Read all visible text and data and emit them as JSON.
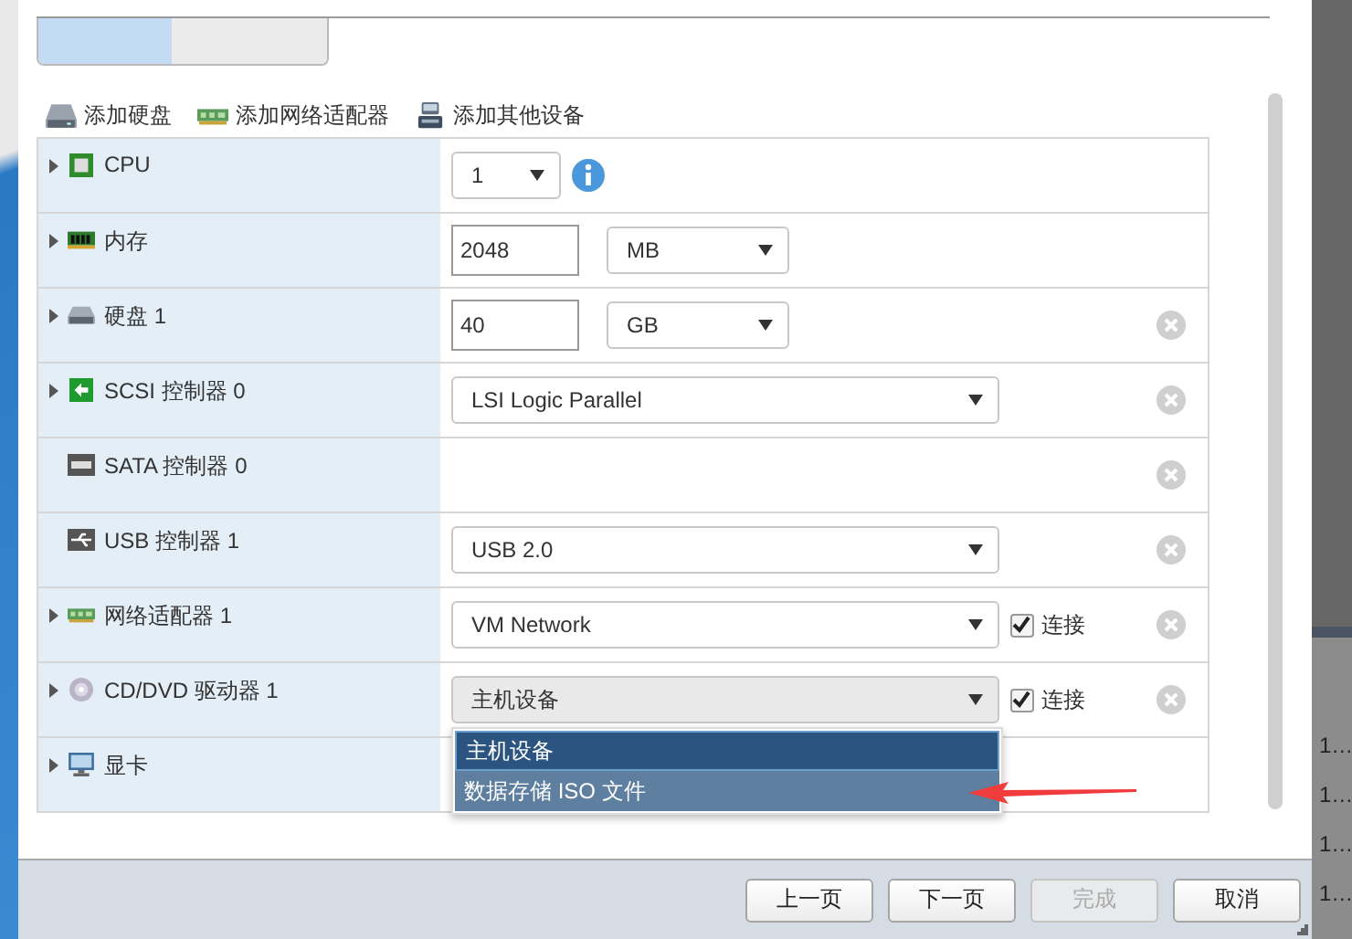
{
  "tabs": [
    {
      "selected": true
    },
    {
      "selected": false
    }
  ],
  "toolbar": [
    {
      "kind": "disk",
      "label": "添加硬盘"
    },
    {
      "kind": "network",
      "label": "添加网络适配器"
    },
    {
      "kind": "device",
      "label": "添加其他设备"
    }
  ],
  "devices": [
    {
      "kind": "cpu",
      "label": "CPU",
      "expandable": true,
      "removable": false,
      "controls": [
        {
          "kind": "count",
          "value": "1",
          "open": false
        },
        {
          "kind": "info"
        }
      ]
    },
    {
      "kind": "memory",
      "label": "内存",
      "expandable": true,
      "removable": false,
      "controls": [
        {
          "kind": "input",
          "value": "2048"
        },
        {
          "kind": "unit",
          "value": "MB",
          "open": false
        }
      ]
    },
    {
      "kind": "disk",
      "label": "硬盘 1",
      "expandable": true,
      "removable": true,
      "controls": [
        {
          "kind": "input",
          "value": "40"
        },
        {
          "kind": "unit",
          "value": "GB",
          "open": false
        }
      ]
    },
    {
      "kind": "scsi",
      "label": "SCSI 控制器 0",
      "expandable": true,
      "removable": true,
      "controls": [
        {
          "kind": "select",
          "value": "LSI Logic Parallel",
          "open": false
        }
      ]
    },
    {
      "kind": "sata",
      "label": "SATA 控制器 0",
      "expandable": false,
      "removable": true
    },
    {
      "kind": "usb",
      "label": "USB 控制器 1",
      "expandable": false,
      "removable": true,
      "controls": [
        {
          "kind": "select",
          "value": "USB 2.0",
          "open": false
        }
      ]
    },
    {
      "kind": "network",
      "label": "网络适配器 1",
      "expandable": true,
      "removable": true,
      "controls": [
        {
          "kind": "select",
          "value": "VM Network",
          "open": false
        },
        {
          "kind": "checkbox",
          "label": "连接",
          "checked": true
        }
      ]
    },
    {
      "kind": "cdrom",
      "label": "CD/DVD 驱动器 1",
      "expandable": true,
      "removable": true,
      "controls": [
        {
          "kind": "select",
          "value": "主机设备",
          "open": true,
          "options": [
            {
              "label": "主机设备",
              "selected": true
            },
            {
              "label": "数据存储 ISO 文件",
              "selected": false
            }
          ]
        },
        {
          "kind": "checkbox",
          "label": "连接",
          "checked": true
        }
      ]
    },
    {
      "kind": "display",
      "label": "显卡",
      "expandable": true,
      "removable": false
    }
  ],
  "buttons": [
    {
      "label": "上一页",
      "disabled": false
    },
    {
      "label": "下一页",
      "disabled": false
    },
    {
      "label": "完成",
      "disabled": true
    },
    {
      "label": "取消",
      "disabled": false
    }
  ],
  "side_panel": {
    "items": [
      "1…",
      "1…",
      "1…",
      "1…"
    ]
  }
}
